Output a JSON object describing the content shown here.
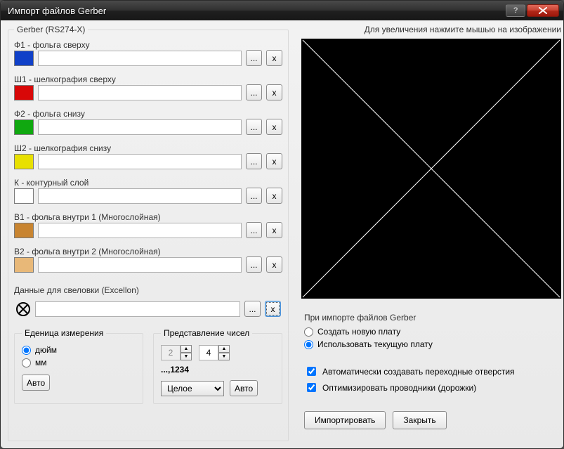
{
  "window": {
    "title": "Импорт файлов Gerber"
  },
  "preview_hint": "Для увеличения нажмите мышью на изображении",
  "gerber": {
    "legend": "Gerber (RS274-X)",
    "layers": [
      {
        "label": "Ф1 - фольга сверху",
        "color": "#1040c8",
        "path": ""
      },
      {
        "label": "Ш1 - шелкография сверху",
        "color": "#d80808",
        "path": ""
      },
      {
        "label": "Ф2 - фольга снизу",
        "color": "#10a810",
        "path": ""
      },
      {
        "label": "Ш2 - шелкография снизу",
        "color": "#e8e000",
        "path": ""
      },
      {
        "label": "К - контурный слой",
        "color": "#ffffff",
        "path": ""
      },
      {
        "label": "В1 - фольга внутри 1 (Многослойная)",
        "color": "#c88430",
        "path": ""
      },
      {
        "label": "В2 - фольга внутри 2 (Многослойная)",
        "color": "#e8b878",
        "path": ""
      }
    ],
    "browse_label": "...",
    "clear_label": "x"
  },
  "drill": {
    "section_label": "Данные для свеловки (Excellon)",
    "path": "",
    "browse_label": "...",
    "clear_label": "x"
  },
  "units": {
    "legend": "Еденица измерения",
    "options": {
      "inch": "дюйм",
      "mm": "мм"
    },
    "selected": "inch",
    "auto_label": "Авто"
  },
  "numfmt": {
    "legend": "Представление чисел",
    "int_digits": "2",
    "frac_digits": "4",
    "example": "...,1234",
    "mode": "Целое",
    "auto_label": "Авто"
  },
  "import_opts": {
    "header": "При импорте файлов Gerber",
    "options": {
      "create": "Создать новую плату",
      "use": "Использовать текущую плату"
    },
    "selected": "use",
    "auto_vias": {
      "checked": true,
      "label": "Автоматически создавать переходные отверстия"
    },
    "optimize": {
      "checked": true,
      "label": "Оптимизировать проводники (дорожки)"
    }
  },
  "actions": {
    "import": "Импортировать",
    "close": "Закрыть"
  }
}
